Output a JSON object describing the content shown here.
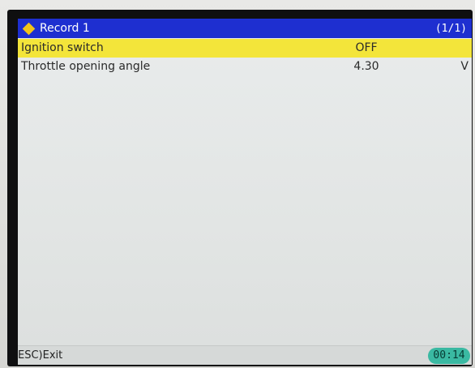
{
  "header": {
    "title": "Record 1",
    "page_indicator": "(1/1)",
    "icon": "diamond-icon"
  },
  "rows": [
    {
      "label": "Ignition switch",
      "value": "OFF",
      "unit": "",
      "selected": true
    },
    {
      "label": "Throttle opening angle",
      "value": "4.30",
      "unit": "V",
      "selected": false
    }
  ],
  "footer": {
    "esc_label": "ESC)Exit",
    "time": "00:14"
  },
  "colors": {
    "title_bar": "#1e2fd0",
    "selection": "#f3e53a",
    "time_badge": "#3ab9a2",
    "diamond": "#f2c419"
  }
}
